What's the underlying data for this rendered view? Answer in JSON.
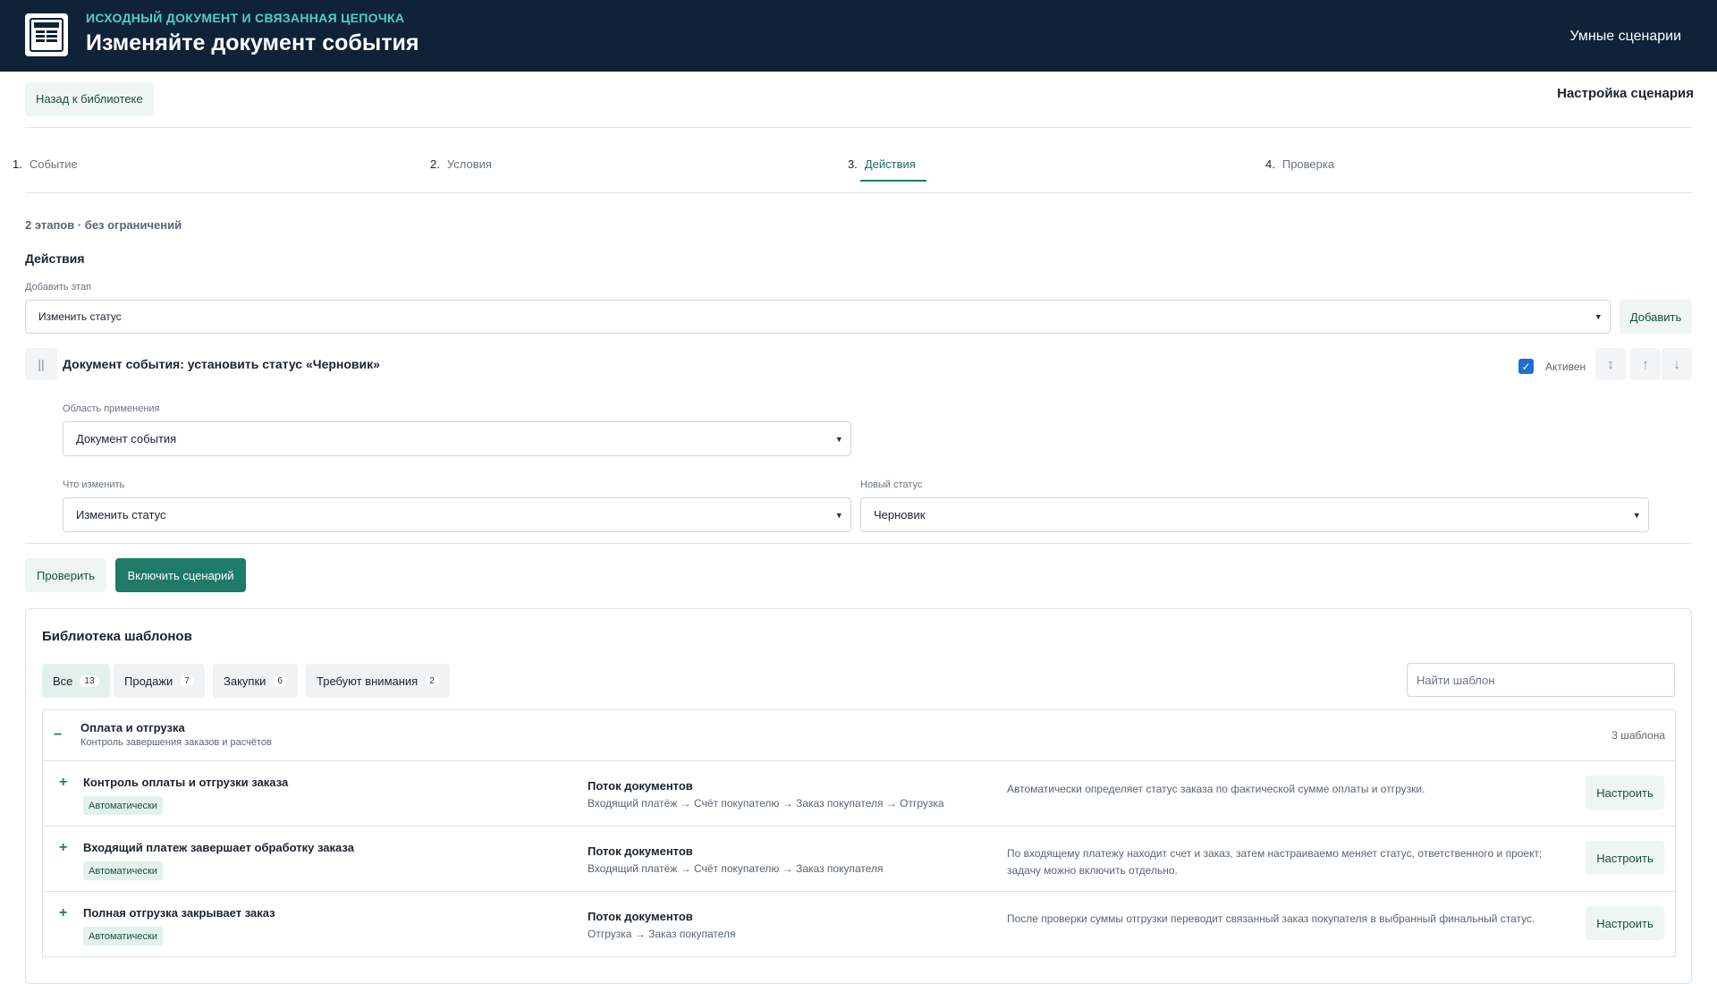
{
  "header": {
    "eyebrow": "ИСХОДНЫЙ ДОКУМЕНТ И СВЯЗАННАЯ ЦЕПОЧКА",
    "title": "Изменяйте документ события",
    "right_link": "Умные сценарии"
  },
  "toolbar": {
    "back_label": "Назад к библиотеке",
    "setup_title": "Настройка сценария"
  },
  "steps": [
    {
      "num": "1.",
      "label": "Событие"
    },
    {
      "num": "2.",
      "label": "Условия"
    },
    {
      "num": "3.",
      "label": "Действия"
    },
    {
      "num": "4.",
      "label": "Проверка"
    }
  ],
  "meta": "2 этапов · без ограничений",
  "actions": {
    "heading": "Действия",
    "add_stage_label": "Добавить этап",
    "add_stage_value": "Изменить статус",
    "add_button": "Добавить"
  },
  "stage": {
    "handle": "||",
    "title": "Документ события: установить статус «Черновик»",
    "active_label": "Активен",
    "scope_label": "Область применения",
    "scope_value": "Документ события",
    "what_label": "Что изменить",
    "what_value": "Изменить статус",
    "status_label": "Новый статус",
    "status_value": "Черновик"
  },
  "footer_buttons": {
    "check": "Проверить",
    "enable": "Включить сценарий"
  },
  "library": {
    "title": "Библиотека шаблонов",
    "search_placeholder": "Найти шаблон",
    "filters": [
      {
        "label": "Все",
        "count": "13"
      },
      {
        "label": "Продажи",
        "count": "7"
      },
      {
        "label": "Закупки",
        "count": "6"
      },
      {
        "label": "Требуют внимания",
        "count": "2"
      }
    ],
    "group": {
      "title": "Оплата и отгрузка",
      "subtitle": "Контроль завершения заказов и расчётов",
      "count": "3 шаблона"
    },
    "rows": [
      {
        "title": "Контроль оплаты и отгрузки заказа",
        "badge": "Автоматически",
        "flow_heading": "Поток документов",
        "flow": "Входящий платёж → Счёт покупателю → Заказ покупателя → Отгрузка",
        "description": "Автоматически определяет статус заказа по фактической сумме оплаты и отгрузки.",
        "button": "Настроить"
      },
      {
        "title": "Входящий платеж завершает обработку заказа",
        "badge": "Автоматически",
        "flow_heading": "Поток документов",
        "flow": "Входящий платёж → Счёт покупателю → Заказ покупателя",
        "description": "По входящему платежу находит счет и заказ, затем настраиваемо меняет статус, ответственного и проект; задачу можно включить отдельно.",
        "button": "Настроить"
      },
      {
        "title": "Полная отгрузка закрывает заказ",
        "badge": "Автоматически",
        "flow_heading": "Поток документов",
        "flow": "Отгрузка → Заказ покупателя",
        "description": "После проверки суммы отгрузки переводит связанный заказ покупателя в выбранный финальный статус.",
        "button": "Настроить"
      }
    ]
  },
  "icons": {
    "logo": "document-list-icon",
    "chevron": "▾",
    "plus": "+",
    "minus": "−",
    "check": "✓",
    "swap": "↕",
    "up": "↑",
    "down": "↓"
  },
  "colors": {
    "header_bg": "#0f2237",
    "accent": "#1f7a68",
    "eyebrow": "#4fd1c5"
  }
}
